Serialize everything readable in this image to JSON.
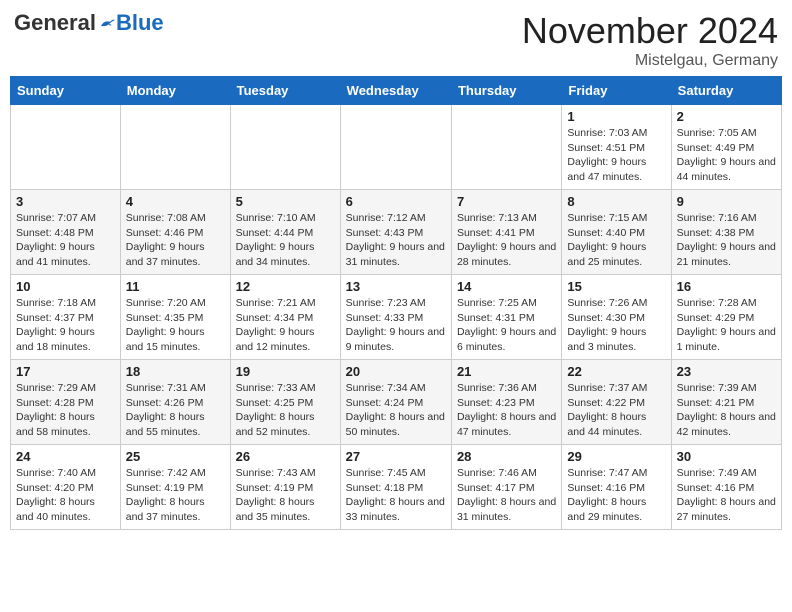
{
  "logo": {
    "general": "General",
    "blue": "Blue"
  },
  "title": "November 2024",
  "location": "Mistelgau, Germany",
  "weekdays": [
    "Sunday",
    "Monday",
    "Tuesday",
    "Wednesday",
    "Thursday",
    "Friday",
    "Saturday"
  ],
  "weeks": [
    [
      {
        "day": "",
        "info": ""
      },
      {
        "day": "",
        "info": ""
      },
      {
        "day": "",
        "info": ""
      },
      {
        "day": "",
        "info": ""
      },
      {
        "day": "",
        "info": ""
      },
      {
        "day": "1",
        "info": "Sunrise: 7:03 AM\nSunset: 4:51 PM\nDaylight: 9 hours and 47 minutes."
      },
      {
        "day": "2",
        "info": "Sunrise: 7:05 AM\nSunset: 4:49 PM\nDaylight: 9 hours and 44 minutes."
      }
    ],
    [
      {
        "day": "3",
        "info": "Sunrise: 7:07 AM\nSunset: 4:48 PM\nDaylight: 9 hours and 41 minutes."
      },
      {
        "day": "4",
        "info": "Sunrise: 7:08 AM\nSunset: 4:46 PM\nDaylight: 9 hours and 37 minutes."
      },
      {
        "day": "5",
        "info": "Sunrise: 7:10 AM\nSunset: 4:44 PM\nDaylight: 9 hours and 34 minutes."
      },
      {
        "day": "6",
        "info": "Sunrise: 7:12 AM\nSunset: 4:43 PM\nDaylight: 9 hours and 31 minutes."
      },
      {
        "day": "7",
        "info": "Sunrise: 7:13 AM\nSunset: 4:41 PM\nDaylight: 9 hours and 28 minutes."
      },
      {
        "day": "8",
        "info": "Sunrise: 7:15 AM\nSunset: 4:40 PM\nDaylight: 9 hours and 25 minutes."
      },
      {
        "day": "9",
        "info": "Sunrise: 7:16 AM\nSunset: 4:38 PM\nDaylight: 9 hours and 21 minutes."
      }
    ],
    [
      {
        "day": "10",
        "info": "Sunrise: 7:18 AM\nSunset: 4:37 PM\nDaylight: 9 hours and 18 minutes."
      },
      {
        "day": "11",
        "info": "Sunrise: 7:20 AM\nSunset: 4:35 PM\nDaylight: 9 hours and 15 minutes."
      },
      {
        "day": "12",
        "info": "Sunrise: 7:21 AM\nSunset: 4:34 PM\nDaylight: 9 hours and 12 minutes."
      },
      {
        "day": "13",
        "info": "Sunrise: 7:23 AM\nSunset: 4:33 PM\nDaylight: 9 hours and 9 minutes."
      },
      {
        "day": "14",
        "info": "Sunrise: 7:25 AM\nSunset: 4:31 PM\nDaylight: 9 hours and 6 minutes."
      },
      {
        "day": "15",
        "info": "Sunrise: 7:26 AM\nSunset: 4:30 PM\nDaylight: 9 hours and 3 minutes."
      },
      {
        "day": "16",
        "info": "Sunrise: 7:28 AM\nSunset: 4:29 PM\nDaylight: 9 hours and 1 minute."
      }
    ],
    [
      {
        "day": "17",
        "info": "Sunrise: 7:29 AM\nSunset: 4:28 PM\nDaylight: 8 hours and 58 minutes."
      },
      {
        "day": "18",
        "info": "Sunrise: 7:31 AM\nSunset: 4:26 PM\nDaylight: 8 hours and 55 minutes."
      },
      {
        "day": "19",
        "info": "Sunrise: 7:33 AM\nSunset: 4:25 PM\nDaylight: 8 hours and 52 minutes."
      },
      {
        "day": "20",
        "info": "Sunrise: 7:34 AM\nSunset: 4:24 PM\nDaylight: 8 hours and 50 minutes."
      },
      {
        "day": "21",
        "info": "Sunrise: 7:36 AM\nSunset: 4:23 PM\nDaylight: 8 hours and 47 minutes."
      },
      {
        "day": "22",
        "info": "Sunrise: 7:37 AM\nSunset: 4:22 PM\nDaylight: 8 hours and 44 minutes."
      },
      {
        "day": "23",
        "info": "Sunrise: 7:39 AM\nSunset: 4:21 PM\nDaylight: 8 hours and 42 minutes."
      }
    ],
    [
      {
        "day": "24",
        "info": "Sunrise: 7:40 AM\nSunset: 4:20 PM\nDaylight: 8 hours and 40 minutes."
      },
      {
        "day": "25",
        "info": "Sunrise: 7:42 AM\nSunset: 4:19 PM\nDaylight: 8 hours and 37 minutes."
      },
      {
        "day": "26",
        "info": "Sunrise: 7:43 AM\nSunset: 4:19 PM\nDaylight: 8 hours and 35 minutes."
      },
      {
        "day": "27",
        "info": "Sunrise: 7:45 AM\nSunset: 4:18 PM\nDaylight: 8 hours and 33 minutes."
      },
      {
        "day": "28",
        "info": "Sunrise: 7:46 AM\nSunset: 4:17 PM\nDaylight: 8 hours and 31 minutes."
      },
      {
        "day": "29",
        "info": "Sunrise: 7:47 AM\nSunset: 4:16 PM\nDaylight: 8 hours and 29 minutes."
      },
      {
        "day": "30",
        "info": "Sunrise: 7:49 AM\nSunset: 4:16 PM\nDaylight: 8 hours and 27 minutes."
      }
    ]
  ]
}
